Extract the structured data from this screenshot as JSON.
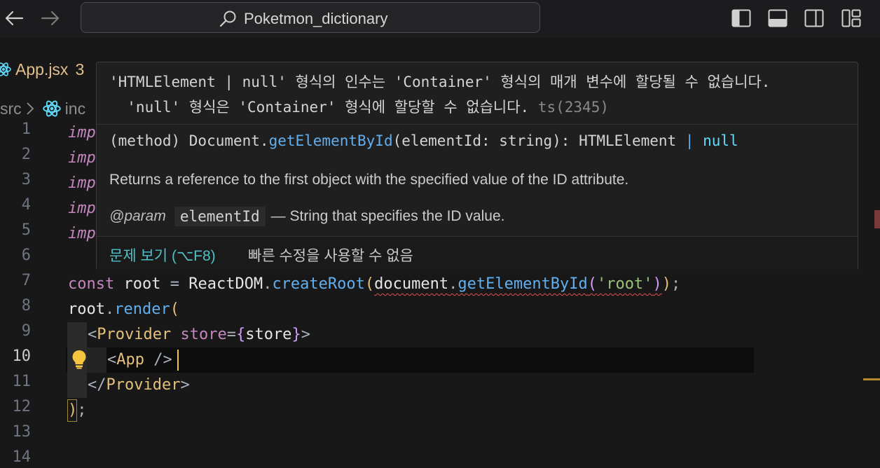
{
  "titlebar": {
    "search_title": "Poketmon_dictionary"
  },
  "tab": {
    "label": "App.jsx",
    "count": "3"
  },
  "breadcrumb": {
    "folder": "src",
    "file": "inc"
  },
  "gutter": {
    "lines": [
      "1",
      "2",
      "3",
      "4",
      "5",
      "6",
      "7",
      "8",
      "9",
      "10",
      "11",
      "12",
      "13",
      "14"
    ]
  },
  "code": {
    "import_partial": "imp",
    "line7": {
      "const": "const",
      "root": "root",
      "eq": " = ",
      "reactdom": "ReactDOM",
      "dot1": ".",
      "createRoot": "createRoot",
      "open": "(",
      "document": "document",
      "dot2": ".",
      "getEl": "getElementById",
      "open2": "(",
      "str": "'root'",
      "close2": ")",
      "close": ")",
      "semi": ";"
    },
    "line8": {
      "root": "root",
      "dot": ".",
      "render": "render",
      "open": "("
    },
    "line9": {
      "lt": "<",
      "tag": "Provider",
      "attr": "store",
      "eq": "=",
      "open": "{",
      "val": "store",
      "close": "}",
      "gt": ">"
    },
    "line10": {
      "lt": "<",
      "tag": "App",
      "end": " />"
    },
    "line11": {
      "lt": "</",
      "tag": "Provider",
      "gt": ">"
    },
    "line12": {
      "close": ")",
      "semi": ";"
    }
  },
  "hover": {
    "error_line1": "'HTMLElement | null' 형식의 인수는 'Container' 형식의 매개 변수에 할당될 수 없습니다.",
    "error_line2": "  'null' 형식은 'Container' 형식에 할당할 수 없습니다. ",
    "error_code": "ts(2345)",
    "sig_prefix": "(method) Document.",
    "sig_method": "getElementById",
    "sig_rest": "(elementId: string): HTMLElement ",
    "sig_pipe": "|",
    "sig_null": " null",
    "doc": "Returns a reference to the first object with the specified value of the ID attribute.",
    "param_tag": "@param",
    "param_name": "elementId",
    "param_desc": "— String that specifies the ID value.",
    "action_view_problem": "문제 보기 (⌥F8)",
    "action_no_fix": "빠른 수정을 사용할 수 없음"
  },
  "colors": {
    "background": "#181818",
    "accent_link": "#4fc1c9",
    "error": "#e05252",
    "modified_tab": "#e2c08d"
  }
}
